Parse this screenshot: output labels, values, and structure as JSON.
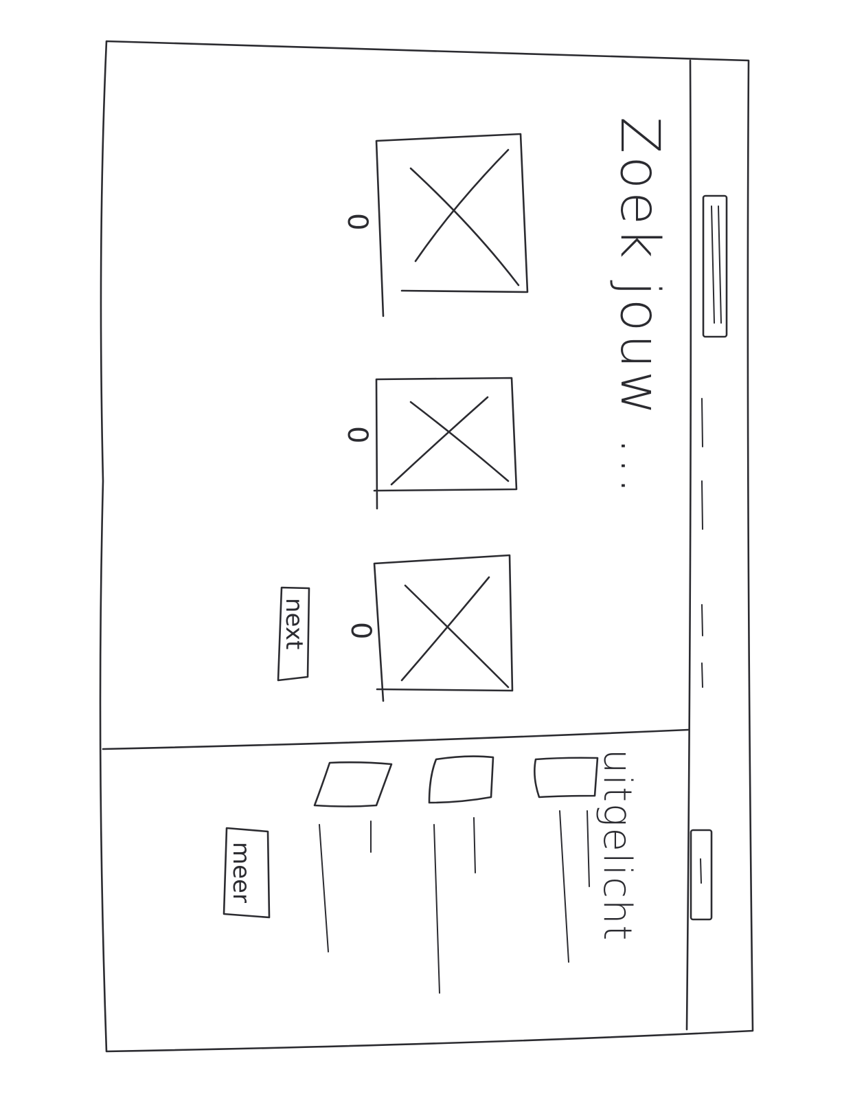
{
  "main": {
    "title": "Zoek jouw ...",
    "options": [
      {
        "marker": "0"
      },
      {
        "marker": "0"
      },
      {
        "marker": "0"
      }
    ],
    "next_label": "next"
  },
  "sidebar": {
    "title": "uitgelicht",
    "more_label": "meer"
  }
}
